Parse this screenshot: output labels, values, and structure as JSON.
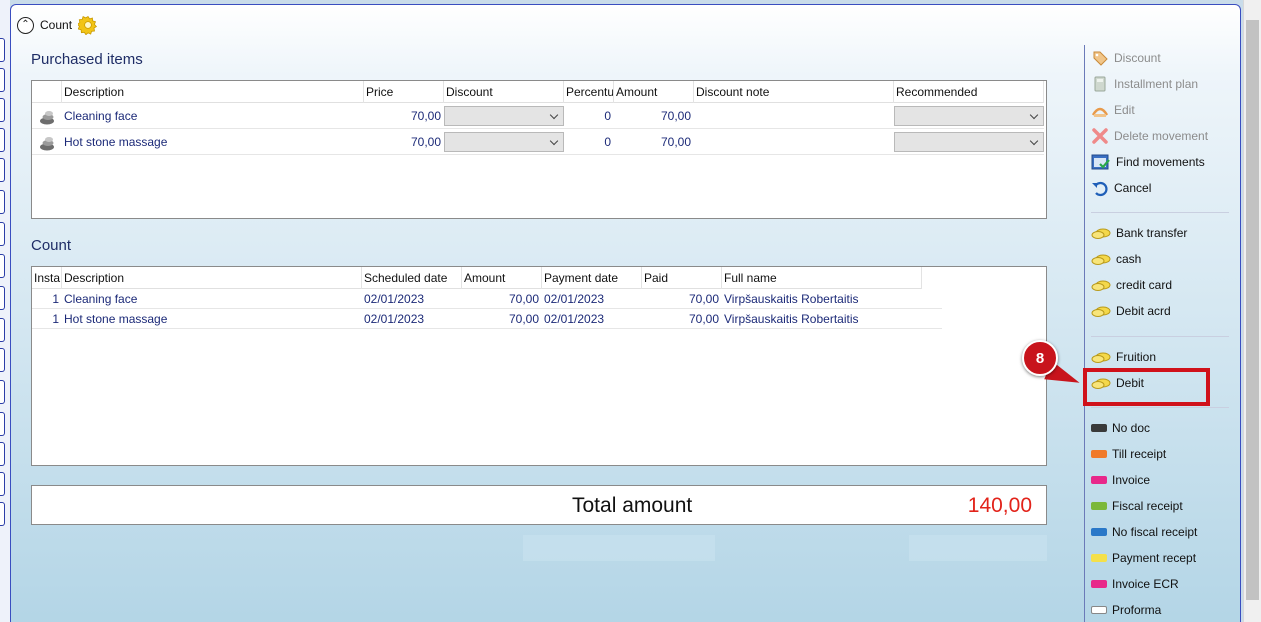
{
  "header": {
    "title": "Count",
    "collapse_icon": "chevron-up-circle-icon",
    "settings_icon": "gear-icon"
  },
  "purchased": {
    "title": "Purchased items",
    "columns": [
      "Description",
      "Price",
      "Discount",
      "Percentu",
      "Amount",
      "Discount note",
      "Recommended"
    ],
    "rows": [
      {
        "description": "Cleaning face",
        "price": "70,00",
        "discount": "",
        "percent": "0",
        "amount": "70,00",
        "note": "",
        "recommended": ""
      },
      {
        "description": "Hot stone massage",
        "price": "70,00",
        "discount": "",
        "percent": "0",
        "amount": "70,00",
        "note": "",
        "recommended": ""
      }
    ]
  },
  "count": {
    "title": "Count",
    "columns": [
      "Insta",
      "Description",
      "Scheduled date",
      "Amount",
      "Payment date",
      "Paid",
      "Full name"
    ],
    "rows": [
      {
        "inst": "1",
        "description": "Cleaning face",
        "scheduled": "02/01/2023",
        "amount": "70,00",
        "payment_date": "02/01/2023",
        "paid": "70,00",
        "name": "Virpšauskaitis Robertaitis"
      },
      {
        "inst": "1",
        "description": "Hot stone massage",
        "scheduled": "02/01/2023",
        "amount": "70,00",
        "payment_date": "02/01/2023",
        "paid": "70,00",
        "name": "Virpšauskaitis Robertaitis"
      }
    ]
  },
  "total": {
    "label": "Total amount",
    "value": "140,00",
    "value_color": "#e2231a"
  },
  "panel": {
    "actions": [
      {
        "label": "Discount",
        "icon": "discount-tag-icon",
        "disabled": true
      },
      {
        "label": "Installment plan",
        "icon": "calculator-icon",
        "disabled": true
      },
      {
        "label": "Edit",
        "icon": "edit-icon",
        "disabled": true
      },
      {
        "label": "Delete movement",
        "icon": "delete-x-icon",
        "disabled": true
      },
      {
        "label": "Find movements",
        "icon": "find-movements-icon",
        "disabled": false
      },
      {
        "label": "Cancel",
        "icon": "undo-arrow-icon",
        "disabled": false
      }
    ],
    "payments": [
      {
        "label": "Bank transfer",
        "icon": "coins-icon"
      },
      {
        "label": "cash",
        "icon": "coins-icon"
      },
      {
        "label": "credit card",
        "icon": "coins-icon"
      },
      {
        "label": "Debit acrd",
        "icon": "coins-icon"
      }
    ],
    "payments2": [
      {
        "label": "Fruition",
        "icon": "coins-icon"
      },
      {
        "label": "Debit",
        "icon": "coins-icon"
      }
    ],
    "documents": [
      {
        "label": "No doc",
        "color": "#3a3a3a"
      },
      {
        "label": "Till receipt",
        "color": "#f07a2a"
      },
      {
        "label": "Invoice",
        "color": "#e8288a"
      },
      {
        "label": "Fiscal receipt",
        "color": "#7cb83a"
      },
      {
        "label": "No fiscal receipt",
        "color": "#2a78c8"
      },
      {
        "label": "Payment recept",
        "color": "#f4e04a"
      },
      {
        "label": "Invoice ECR",
        "color": "#e8288a"
      },
      {
        "label": "Proforma",
        "color": "#ffffff"
      }
    ]
  },
  "annotation": {
    "step": "8"
  }
}
